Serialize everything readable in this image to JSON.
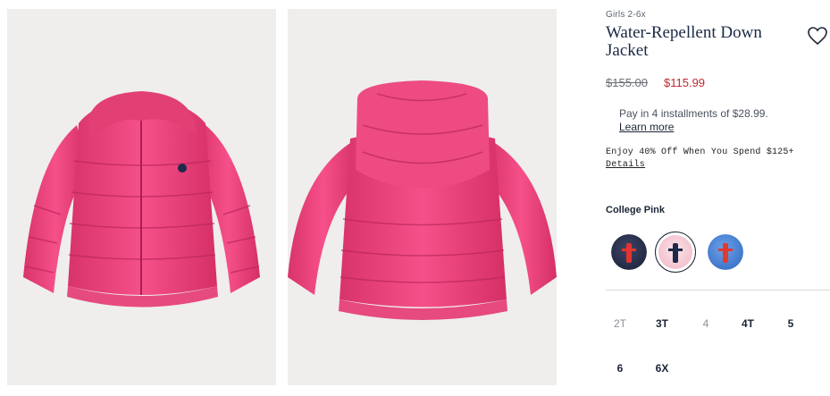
{
  "product": {
    "category": "Girls 2-6x",
    "title": "Water-Repellent Down Jacket",
    "price_original": "$155.00",
    "price_sale": "$115.99",
    "installments_text": "Pay in 4 installments of $28.99.",
    "learn_more": "Learn more",
    "promo_text": "Enjoy 40% Off When You Spend $125+",
    "promo_link": "Details",
    "color_label": "College Pink"
  },
  "swatches": [
    {
      "name": "navy",
      "base": "#2a3150",
      "logo": "#e3342f"
    },
    {
      "name": "college-pink",
      "base": "#f7d8df",
      "logo": "#1e2a4a"
    },
    {
      "name": "blue",
      "base": "#4a86d8",
      "logo": "#e03a2f"
    }
  ],
  "sizes": [
    {
      "label": "2T",
      "available": false
    },
    {
      "label": "3T",
      "available": true
    },
    {
      "label": "4",
      "available": false
    },
    {
      "label": "4T",
      "available": true
    },
    {
      "label": "5",
      "available": true
    },
    {
      "label": "6",
      "available": true
    },
    {
      "label": "6X",
      "available": true
    }
  ],
  "colors": {
    "jacket_pink": "#f0457c",
    "sale_red": "#c1272d",
    "image_bg": "#efeeec"
  },
  "icons": {
    "wishlist": "heart-outline-icon"
  }
}
